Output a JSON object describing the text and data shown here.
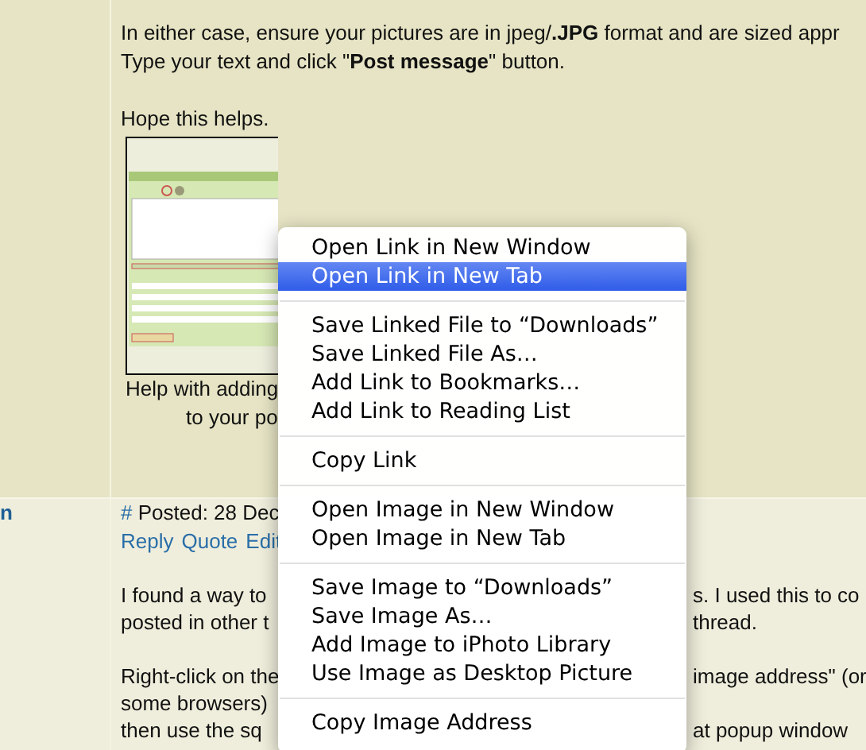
{
  "post_1": {
    "paragraphs": [
      "In either case, ensure your pictures are in jpeg/**.JPG** format and are sized appr",
      "Type your text and click \"**Post message**\" button.",
      "Hope this helps."
    ],
    "caption_lines": [
      "Help with adding",
      "to your po"
    ]
  },
  "post_2": {
    "author": "n",
    "anchor": "#",
    "posted": "Posted: 28 Dec",
    "actions": [
      "Reply",
      "Quote",
      "Edit"
    ],
    "paragraphs": [
      [
        {
          "left": "I found a way to",
          "right": "s. I used this to co"
        },
        {
          "left": "posted in other t",
          "right": "thread."
        }
      ],
      [
        {
          "left": "Right-click on the",
          "right": "image address\" (or"
        },
        {
          "left": "some browsers)"
        },
        {
          "left": "then use the sq",
          "right": "at popup window"
        }
      ]
    ]
  },
  "context_menu": {
    "groups": [
      {
        "items": [
          {
            "label": "Open Link in New Window",
            "selected": false
          },
          {
            "label": "Open Link in New Tab",
            "selected": true
          }
        ]
      },
      {
        "items": [
          {
            "label": "Save Linked File to “Downloads”",
            "selected": false
          },
          {
            "label": "Save Linked File As…",
            "selected": false
          },
          {
            "label": "Add Link to Bookmarks…",
            "selected": false
          },
          {
            "label": "Add Link to Reading List",
            "selected": false
          }
        ]
      },
      {
        "items": [
          {
            "label": "Copy Link",
            "selected": false
          }
        ]
      },
      {
        "items": [
          {
            "label": "Open Image in New Window",
            "selected": false
          },
          {
            "label": "Open Image in New Tab",
            "selected": false
          }
        ]
      },
      {
        "items": [
          {
            "label": "Save Image to “Downloads”",
            "selected": false
          },
          {
            "label": "Save Image As…",
            "selected": false
          },
          {
            "label": "Add Image to iPhoto Library",
            "selected": false
          },
          {
            "label": "Use Image as Desktop Picture",
            "selected": false
          }
        ]
      },
      {
        "items": [
          {
            "label": "Copy Image Address",
            "selected": false
          }
        ]
      }
    ]
  }
}
